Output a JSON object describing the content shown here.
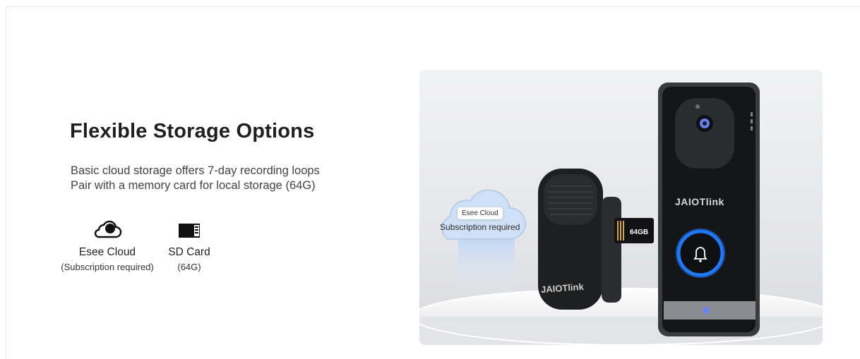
{
  "heading": "Flexible Storage Options",
  "description": {
    "line1": "Basic cloud storage offers 7-day recording loops",
    "line2": "Pair with a memory card for local storage (64G)"
  },
  "features": {
    "cloud": {
      "icon": "cloud-icon",
      "label": "Esee Cloud",
      "sub": "(Subscription required)"
    },
    "sd": {
      "icon": "sd-card-icon",
      "label": "SD Card",
      "sub": "(64G)"
    }
  },
  "product_image": {
    "cloud_tag": "Esee Cloud",
    "cloud_sub": "Subscription required",
    "sd_capacity": "64GB",
    "brand": "JAIOTlink"
  },
  "colors": {
    "accent_ring": "#1e7bff",
    "device": "#1b1c1e"
  }
}
